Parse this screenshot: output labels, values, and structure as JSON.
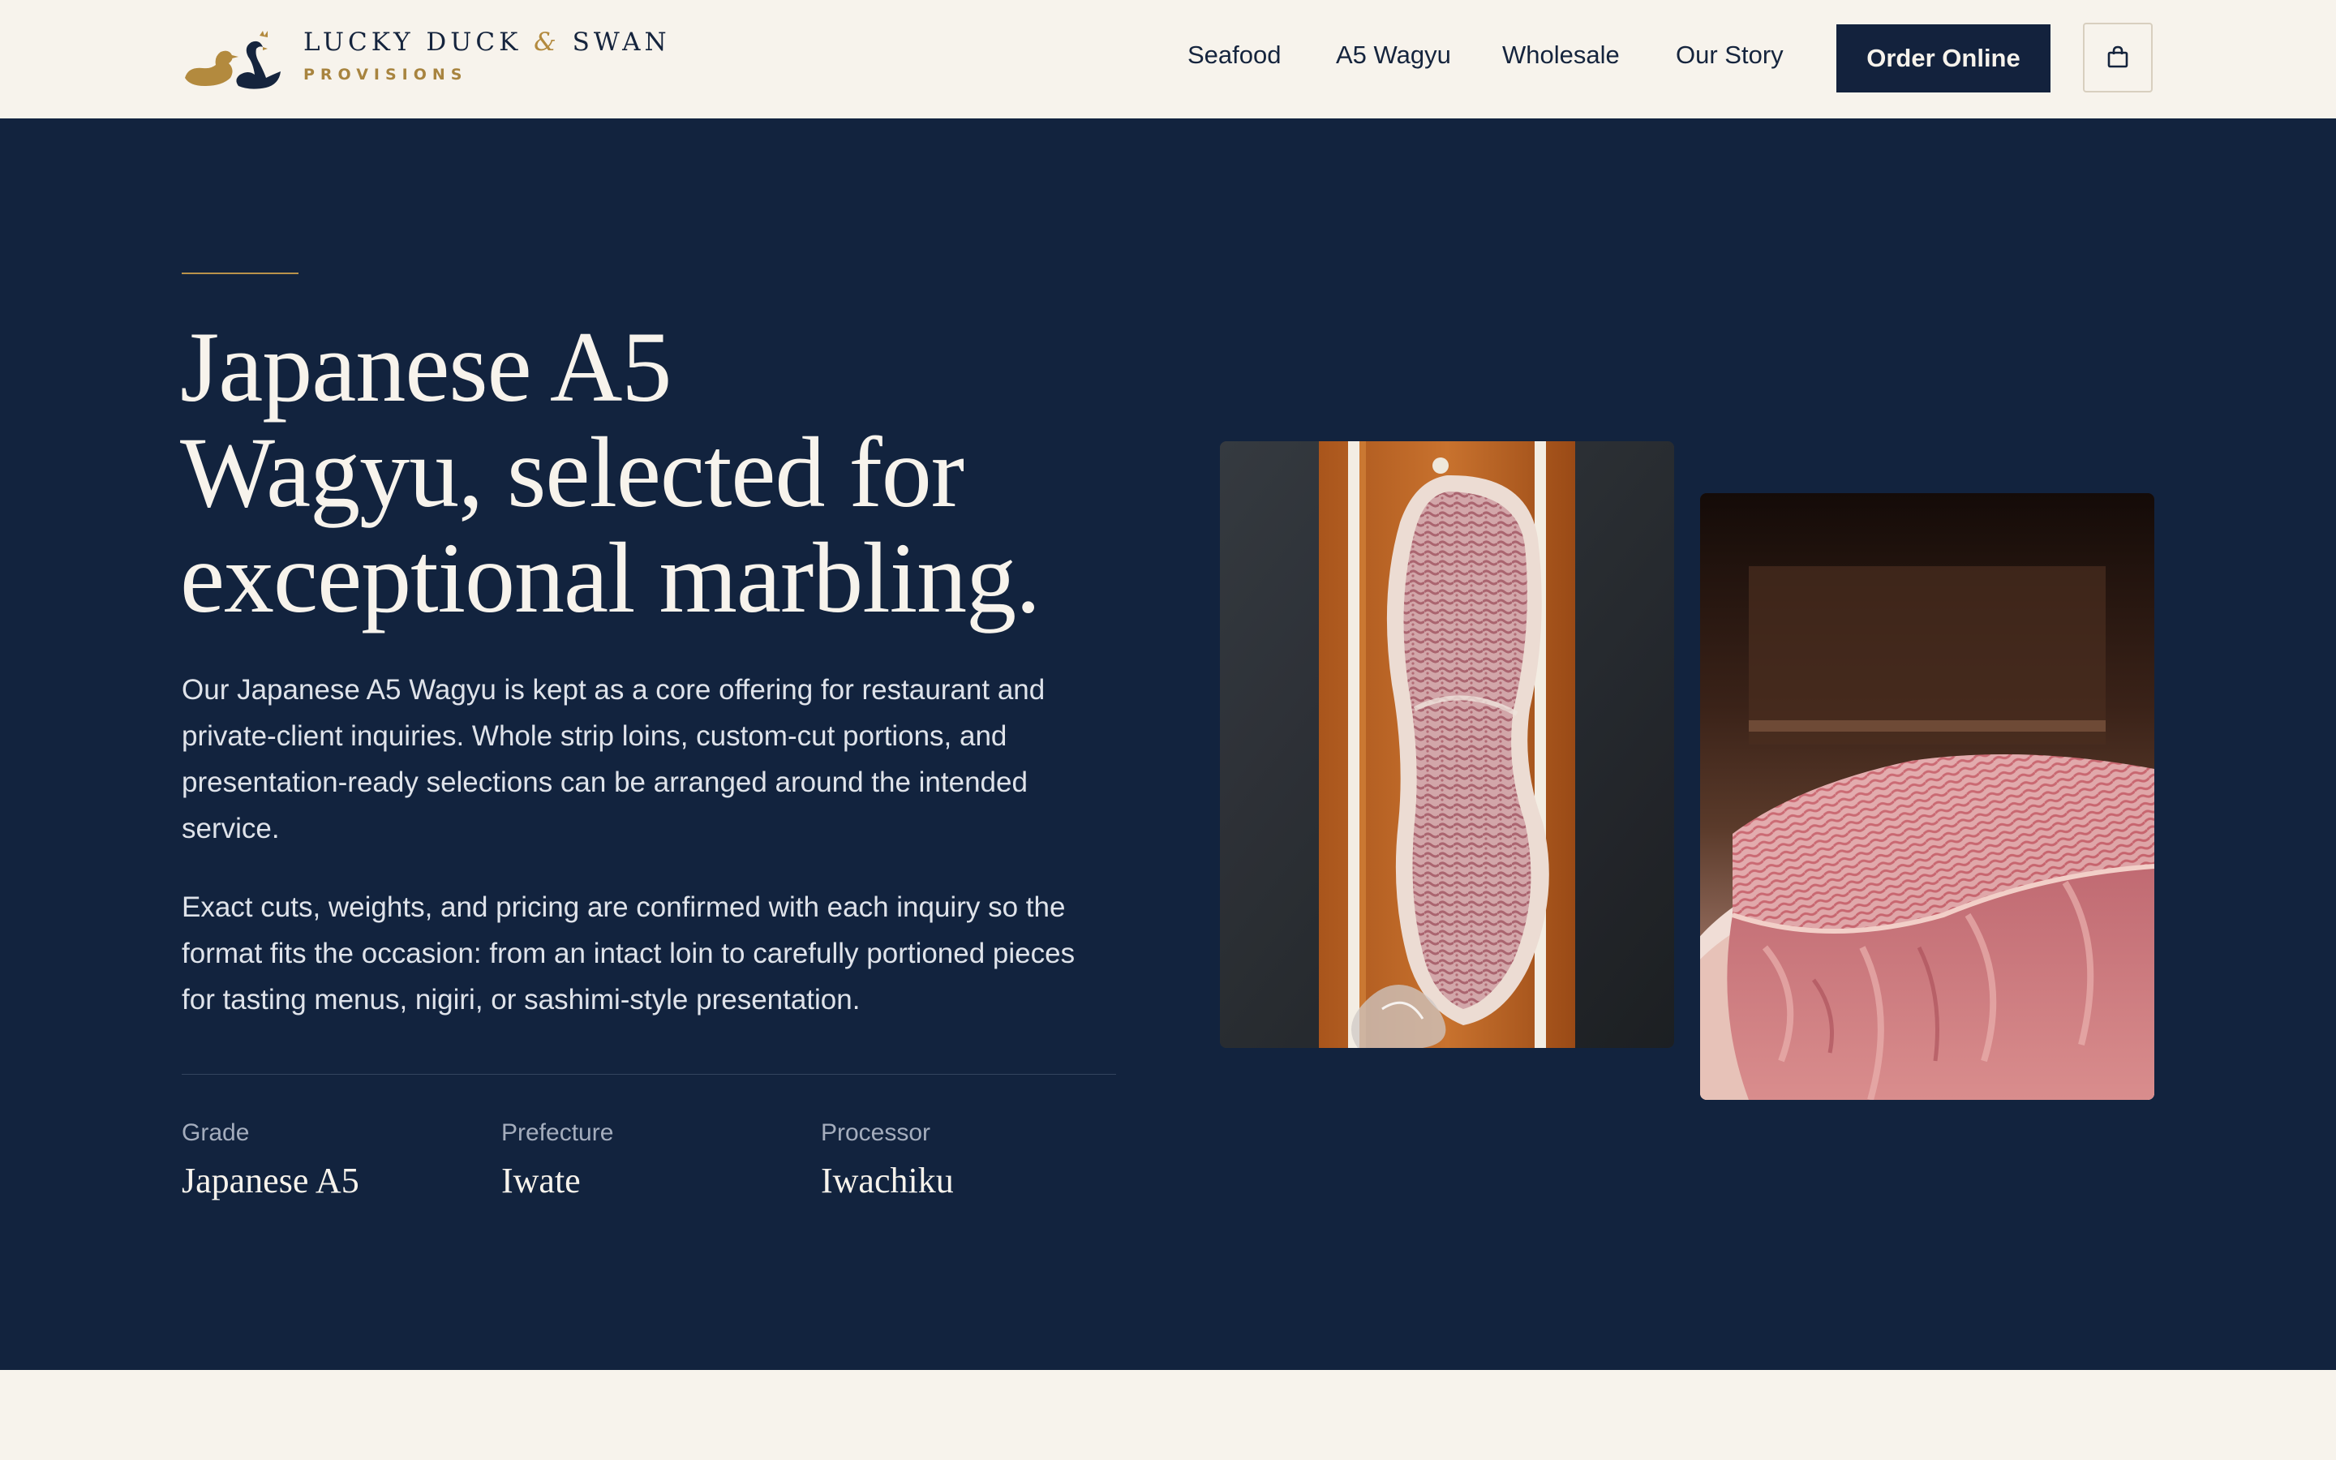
{
  "brand": {
    "name_part1": "LUCKY DUCK",
    "name_amp": "&",
    "name_part2": "SWAN",
    "subtitle": "PROVISIONS"
  },
  "nav": {
    "links": [
      "Seafood",
      "A5 Wagyu",
      "Wholesale",
      "Our Story"
    ],
    "order_button": "Order Online",
    "cart_icon": "shopping-bag-icon"
  },
  "hero": {
    "headline_lines": [
      "Japanese A5",
      "Wagyu, selected for",
      "exceptional marbling."
    ],
    "paragraph_1": "Our Japanese A5 Wagyu is kept as a core offering for restaurant and private-client inquiries. Whole strip loins, custom-cut portions, and presentation-ready selections can be arranged around the intended service.",
    "paragraph_2": "Exact cuts, weights, and pricing are confirmed with each inquiry so the format fits the occasion: from an intact loin to carefully portioned pieces for tasting menus, nigiri, or sashimi-style presentation.",
    "specs": [
      {
        "label": "Grade",
        "value": "Japanese A5"
      },
      {
        "label": "Prefecture",
        "value": "Iwate"
      },
      {
        "label": "Processor",
        "value": "Iwachiku"
      }
    ]
  },
  "colors": {
    "navy": "#12233e",
    "cream": "#f7f3ec",
    "gold": "#b38a3e"
  }
}
